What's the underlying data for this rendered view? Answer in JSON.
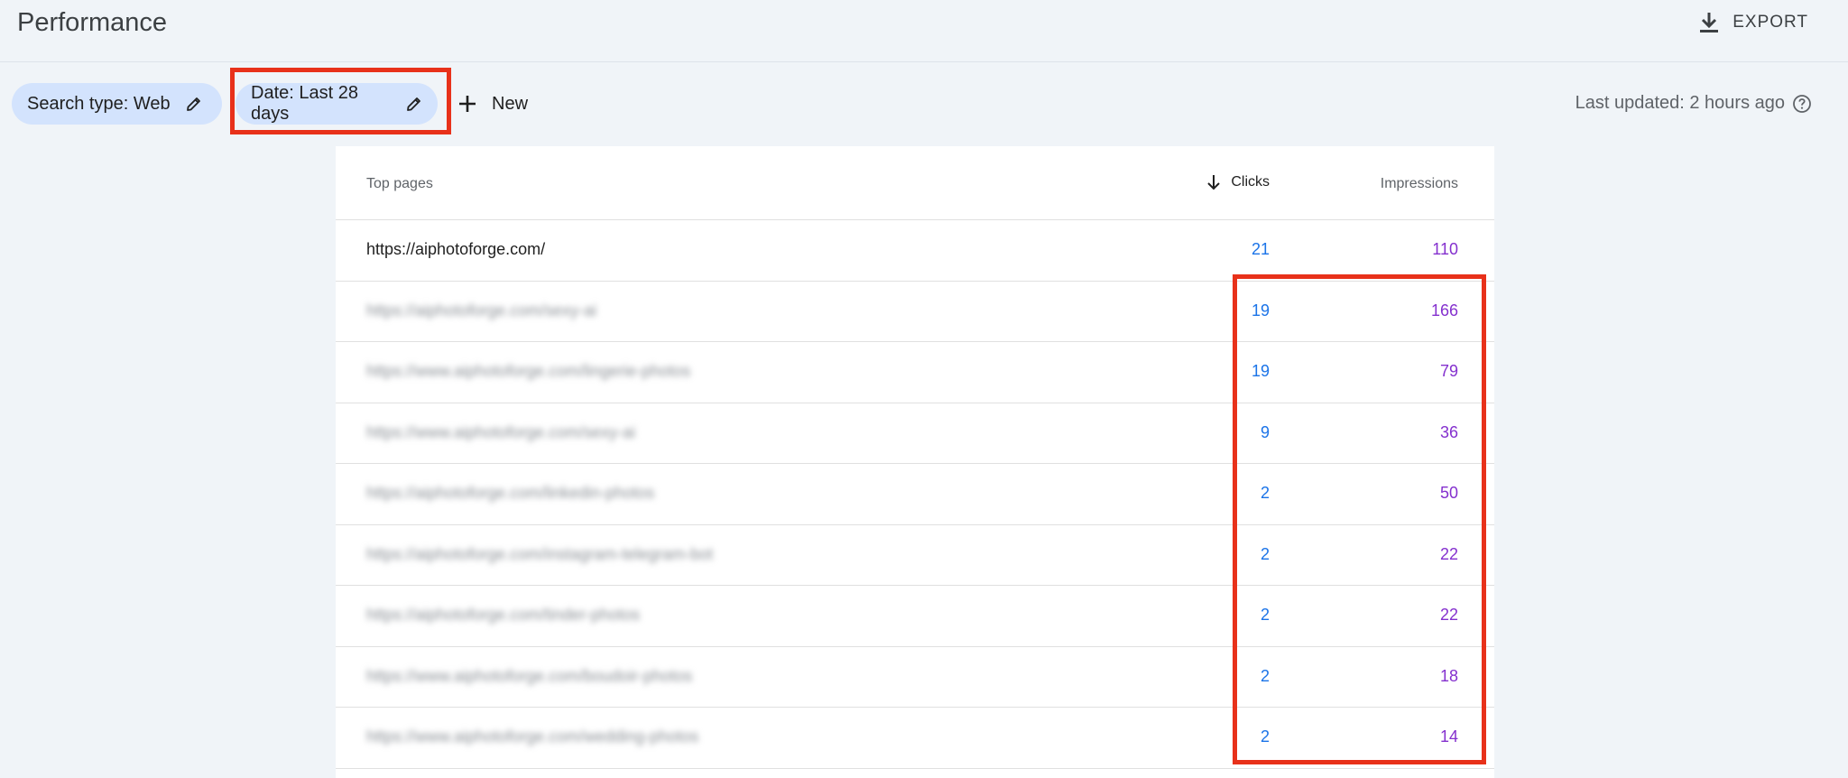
{
  "header": {
    "title": "Performance",
    "export_label": "EXPORT",
    "export_icon": "download-icon"
  },
  "filters": {
    "search_type": "Search type: Web",
    "date": "Date: Last 28 days",
    "new_label": "New",
    "last_updated": "Last updated: 2 hours ago"
  },
  "table": {
    "col_pages": "Top pages",
    "col_clicks": "Clicks",
    "col_impressions": "Impressions",
    "sort_direction": "descending",
    "rows": [
      {
        "url": "https://aiphotoforge.com/",
        "clicks": "21",
        "impressions": "110"
      },
      {
        "url": "https://aiphotoforge.com/sexy-ai",
        "clicks": "19",
        "impressions": "166"
      },
      {
        "url": "https://www.aiphotoforge.com/lingerie-photos",
        "clicks": "19",
        "impressions": "79"
      },
      {
        "url": "https://www.aiphotoforge.com/sexy-ai",
        "clicks": "9",
        "impressions": "36"
      },
      {
        "url": "https://aiphotoforge.com/linkedin-photos",
        "clicks": "2",
        "impressions": "50"
      },
      {
        "url": "https://aiphotoforge.com/instagram-telegram-bot",
        "clicks": "2",
        "impressions": "22"
      },
      {
        "url": "https://aiphotoforge.com/tinder-photos",
        "clicks": "2",
        "impressions": "22"
      },
      {
        "url": "https://www.aiphotoforge.com/boudoir-photos",
        "clicks": "2",
        "impressions": "18"
      },
      {
        "url": "https://www.aiphotoforge.com/wedding-photos",
        "clicks": "2",
        "impressions": "14"
      }
    ]
  },
  "colors": {
    "clicks": "#1a73e8",
    "impressions": "#8430ce",
    "highlight": "#e8311a",
    "chip": "#d3e3fd"
  }
}
